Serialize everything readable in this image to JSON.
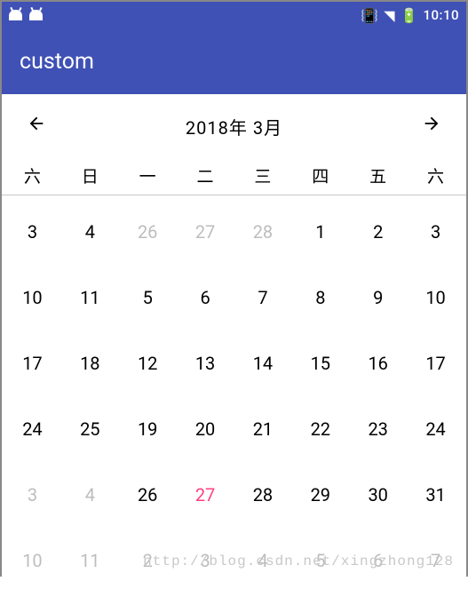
{
  "status_bar": {
    "time": "10:10"
  },
  "app_bar": {
    "title": "custom"
  },
  "calendar": {
    "month_label": "2018年  3月",
    "weekdays": [
      "六",
      "日",
      "一",
      "二",
      "三",
      "四",
      "五",
      "六"
    ],
    "rows": [
      [
        {
          "d": "3",
          "dim": false,
          "today": false
        },
        {
          "d": "4",
          "dim": false,
          "today": false
        },
        {
          "d": "26",
          "dim": true,
          "today": false
        },
        {
          "d": "27",
          "dim": true,
          "today": false
        },
        {
          "d": "28",
          "dim": true,
          "today": false
        },
        {
          "d": "1",
          "dim": false,
          "today": false
        },
        {
          "d": "2",
          "dim": false,
          "today": false
        },
        {
          "d": "3",
          "dim": false,
          "today": false
        }
      ],
      [
        {
          "d": "10",
          "dim": false,
          "today": false
        },
        {
          "d": "11",
          "dim": false,
          "today": false
        },
        {
          "d": "5",
          "dim": false,
          "today": false
        },
        {
          "d": "6",
          "dim": false,
          "today": false
        },
        {
          "d": "7",
          "dim": false,
          "today": false
        },
        {
          "d": "8",
          "dim": false,
          "today": false
        },
        {
          "d": "9",
          "dim": false,
          "today": false
        },
        {
          "d": "10",
          "dim": false,
          "today": false
        }
      ],
      [
        {
          "d": "17",
          "dim": false,
          "today": false
        },
        {
          "d": "18",
          "dim": false,
          "today": false
        },
        {
          "d": "12",
          "dim": false,
          "today": false
        },
        {
          "d": "13",
          "dim": false,
          "today": false
        },
        {
          "d": "14",
          "dim": false,
          "today": false
        },
        {
          "d": "15",
          "dim": false,
          "today": false
        },
        {
          "d": "16",
          "dim": false,
          "today": false
        },
        {
          "d": "17",
          "dim": false,
          "today": false
        }
      ],
      [
        {
          "d": "24",
          "dim": false,
          "today": false
        },
        {
          "d": "25",
          "dim": false,
          "today": false
        },
        {
          "d": "19",
          "dim": false,
          "today": false
        },
        {
          "d": "20",
          "dim": false,
          "today": false
        },
        {
          "d": "21",
          "dim": false,
          "today": false
        },
        {
          "d": "22",
          "dim": false,
          "today": false
        },
        {
          "d": "23",
          "dim": false,
          "today": false
        },
        {
          "d": "24",
          "dim": false,
          "today": false
        }
      ],
      [
        {
          "d": "3",
          "dim": true,
          "today": false
        },
        {
          "d": "4",
          "dim": true,
          "today": false
        },
        {
          "d": "26",
          "dim": false,
          "today": false
        },
        {
          "d": "27",
          "dim": false,
          "today": true
        },
        {
          "d": "28",
          "dim": false,
          "today": false
        },
        {
          "d": "29",
          "dim": false,
          "today": false
        },
        {
          "d": "30",
          "dim": false,
          "today": false
        },
        {
          "d": "31",
          "dim": false,
          "today": false
        }
      ],
      [
        {
          "d": "10",
          "dim": true,
          "today": false
        },
        {
          "d": "11",
          "dim": true,
          "today": false
        },
        {
          "d": "2",
          "dim": true,
          "today": false
        },
        {
          "d": "3",
          "dim": true,
          "today": false
        },
        {
          "d": "4",
          "dim": true,
          "today": false
        },
        {
          "d": "5",
          "dim": true,
          "today": false
        },
        {
          "d": "6",
          "dim": true,
          "today": false
        },
        {
          "d": "7",
          "dim": true,
          "today": false
        }
      ]
    ]
  },
  "watermark": "http://blog.csdn.net/xingzhong128"
}
